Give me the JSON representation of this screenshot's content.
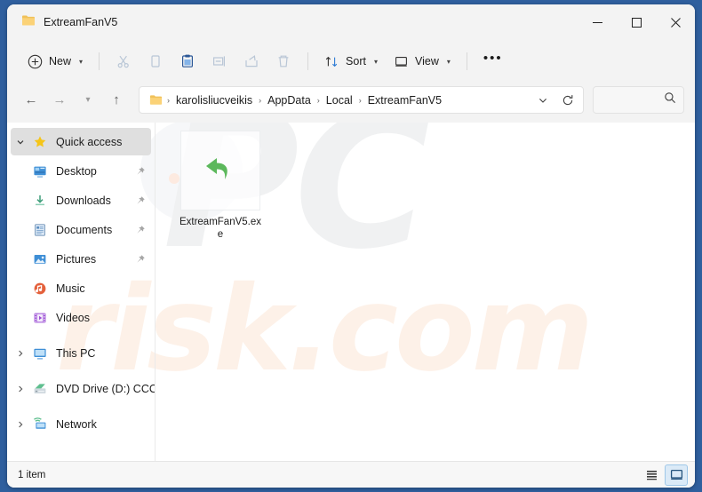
{
  "window": {
    "title": "ExtreamFanV5",
    "title_icon": "folder-icon",
    "minimize_label": "–",
    "maximize_label": "☐",
    "close_label": "✕"
  },
  "toolbar": {
    "new_label": "New",
    "new_icon": "plus-circle-icon",
    "cut_icon": "scissors-icon",
    "copy_icon": "copy-icon",
    "paste_icon": "paste-icon",
    "rename_icon": "rename-icon",
    "share_icon": "share-icon",
    "delete_icon": "trash-icon",
    "sort_label": "Sort",
    "sort_icon": "sort-arrows-icon",
    "view_label": "View",
    "view_icon": "monitor-icon",
    "more_label": "•••"
  },
  "addressbar": {
    "back_label": "←",
    "forward_label": "→",
    "recent_label": "ˇ",
    "up_label": "↑",
    "folder_icon": "folder-icon",
    "crumbs": [
      "karolisliucveikis",
      "AppData",
      "Local",
      "ExtreamFanV5"
    ],
    "separator": "›",
    "dropdown_icon": "chevron-down-icon",
    "refresh_icon": "refresh-icon",
    "search_value": "",
    "search_placeholder": "",
    "search_icon": "search-icon"
  },
  "sidebar": {
    "items": [
      {
        "label": "Quick access",
        "icon": "star-icon",
        "expander": "expanded",
        "pinned": false,
        "selected": true,
        "indent": 0
      },
      {
        "label": "Desktop",
        "icon": "desktop-icon",
        "expander": "none",
        "pinned": true,
        "selected": false,
        "indent": 1
      },
      {
        "label": "Downloads",
        "icon": "downloads-icon",
        "expander": "none",
        "pinned": true,
        "selected": false,
        "indent": 1
      },
      {
        "label": "Documents",
        "icon": "documents-icon",
        "expander": "none",
        "pinned": true,
        "selected": false,
        "indent": 1
      },
      {
        "label": "Pictures",
        "icon": "pictures-icon",
        "expander": "none",
        "pinned": true,
        "selected": false,
        "indent": 1
      },
      {
        "label": "Music",
        "icon": "music-icon",
        "expander": "none",
        "pinned": false,
        "selected": false,
        "indent": 1
      },
      {
        "label": "Videos",
        "icon": "videos-icon",
        "expander": "none",
        "pinned": false,
        "selected": false,
        "indent": 1
      },
      {
        "label": "This PC",
        "icon": "this-pc-icon",
        "expander": "collapsed",
        "pinned": false,
        "selected": false,
        "indent": 0
      },
      {
        "label": "DVD Drive (D:) CCCC",
        "icon": "dvd-drive-icon",
        "expander": "collapsed",
        "pinned": false,
        "selected": false,
        "indent": 0
      },
      {
        "label": "Network",
        "icon": "network-icon",
        "expander": "collapsed",
        "pinned": false,
        "selected": false,
        "indent": 0
      }
    ],
    "expander_expanded": "⌄",
    "expander_collapsed": "›",
    "pin_icon": "pin-icon"
  },
  "files": [
    {
      "name": "ExtreamFanV5.exe",
      "icon": "green-curved-arrow-icon"
    }
  ],
  "statusbar": {
    "item_count": "1 item",
    "details_view_icon": "details-view-icon",
    "large_icons_view_icon": "large-icons-view-icon",
    "active_view": "large-icons"
  },
  "watermark": {
    "top_text": "PC",
    "bottom_text": "risk.com"
  },
  "colors": {
    "window_bg": "#2f5f9e",
    "chrome": "#f3f3f3",
    "accent": "#0067c0",
    "selection": "#dfdfdf",
    "file_icon_green": "#5cb85c",
    "watermark_gray": "#f0f1f2",
    "watermark_peach": "#fdf1e8"
  }
}
